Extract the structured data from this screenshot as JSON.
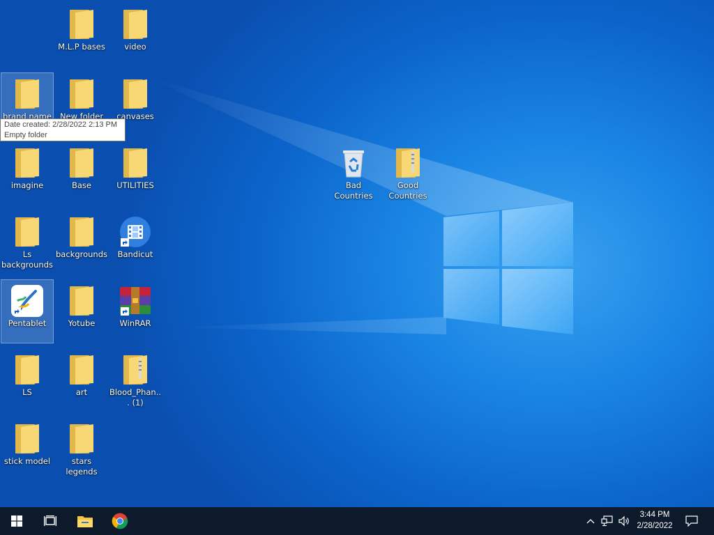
{
  "desktop": {
    "icons": [
      {
        "label": "M.L.P bases",
        "type": "folder"
      },
      {
        "label": "video",
        "type": "folder"
      },
      {
        "label": "brand name",
        "type": "folder"
      },
      {
        "label": "New folder",
        "type": "folder"
      },
      {
        "label": "canvases",
        "type": "folder"
      },
      {
        "label": "imagine",
        "type": "folder"
      },
      {
        "label": "Base",
        "type": "folder"
      },
      {
        "label": "UTILITIES",
        "type": "folder"
      },
      {
        "label": "Ls backgrounds",
        "type": "folder"
      },
      {
        "label": "backgrounds",
        "type": "folder"
      },
      {
        "label": "Bandicut",
        "type": "app-shortcut"
      },
      {
        "label": "Pentablet",
        "type": "app-shortcut"
      },
      {
        "label": "Yotube",
        "type": "folder"
      },
      {
        "label": "WinRAR",
        "type": "app-shortcut"
      },
      {
        "label": "LS",
        "type": "folder"
      },
      {
        "label": "art",
        "type": "folder"
      },
      {
        "label": "Blood_Phan... (1)",
        "type": "zip-folder"
      },
      {
        "label": "stick model",
        "type": "folder"
      },
      {
        "label": "stars legends",
        "type": "folder"
      },
      {
        "label": "Bad Countries",
        "type": "recycle-bin"
      },
      {
        "label": "Good Countries",
        "type": "zip-folder"
      }
    ],
    "tooltip": {
      "line1": "Date created: 2/28/2022 2:13 PM",
      "line2": "Empty folder"
    }
  },
  "taskbar": {
    "clock_time": "3:44 PM",
    "clock_date": "2/28/2022",
    "pinned": [
      "start-icon",
      "task-view-icon",
      "file-explorer-icon",
      "chrome-icon"
    ],
    "tray": [
      "show-hidden-icons-chevron",
      "network-icon",
      "volume-icon",
      "notification-icon"
    ]
  },
  "colors": {
    "folder_yellow": "#f8d775",
    "folder_dark": "#e3b84a",
    "taskbar_bg": "#0c1a2b",
    "desktop_blue": "#1a85e4"
  }
}
